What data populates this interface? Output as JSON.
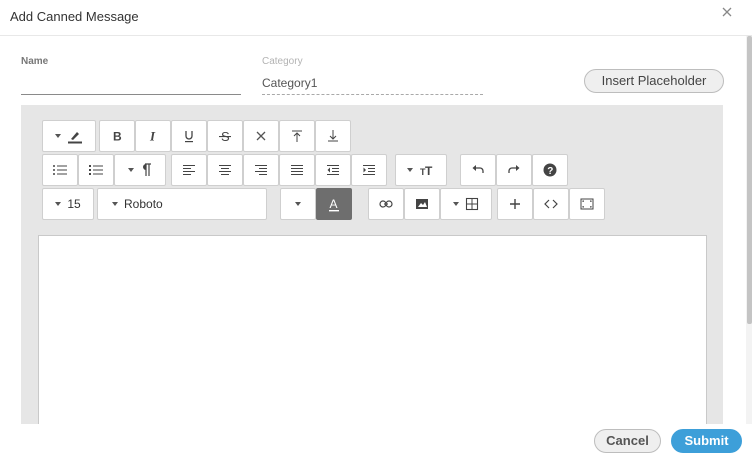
{
  "dialog": {
    "title": "Add Canned Message"
  },
  "form": {
    "name_label": "Name",
    "name_value": "",
    "category_label": "Category",
    "category_value": "Category1",
    "insert_placeholder_label": "Insert Placeholder"
  },
  "toolbar": {
    "font_size": "15",
    "font_family": "Roboto",
    "text_color_letter": "A"
  },
  "footer": {
    "cancel_label": "Cancel",
    "submit_label": "Submit"
  },
  "colors": {
    "accent": "#3d9fd9",
    "editor_bg": "#e6e6e6",
    "active_button": "#6e6e6e"
  },
  "icons": [
    "highlighter-icon",
    "bold-icon",
    "italic-icon",
    "underline-icon",
    "strikethrough-icon",
    "clear-format-icon",
    "superscript-icon",
    "subscript-icon",
    "unordered-list-icon",
    "ordered-list-icon",
    "paragraph-format-icon",
    "align-left-icon",
    "align-center-icon",
    "align-right-icon",
    "align-justify-icon",
    "outdent-icon",
    "indent-icon",
    "line-height-icon",
    "undo-icon",
    "redo-icon",
    "help-icon",
    "link-icon",
    "image-icon",
    "table-icon",
    "insert-icon",
    "code-view-icon",
    "fullscreen-icon"
  ]
}
